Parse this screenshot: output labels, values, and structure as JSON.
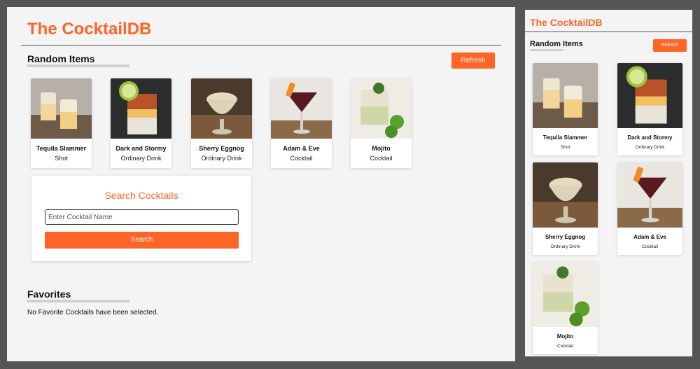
{
  "brand": {
    "title": "The CocktailDB",
    "accent": "#ff6526"
  },
  "random": {
    "title": "Random Items",
    "refresh_label": "Refresh"
  },
  "drinks": [
    {
      "name": "Tequila Slammer",
      "category": "Shot",
      "image": "tequila-slammer-photo"
    },
    {
      "name": "Dark and Stormy",
      "category": "Ordinary Drink",
      "image": "dark-and-stormy-photo"
    },
    {
      "name": "Sherry Eggnog",
      "category": "Ordinary Drink",
      "image": "sherry-eggnog-photo"
    },
    {
      "name": "Adam & Eve",
      "category": "Cocktail",
      "image": "adam-and-eve-photo"
    },
    {
      "name": "Mojito",
      "category": "Cocktail",
      "image": "mojito-photo"
    }
  ],
  "search": {
    "title": "Search Cocktails",
    "placeholder": "Enter Cocktail Name",
    "button_label": "Search"
  },
  "favorites": {
    "title": "Favorites",
    "empty_text": "No Favorite Cocktails have been selected."
  }
}
